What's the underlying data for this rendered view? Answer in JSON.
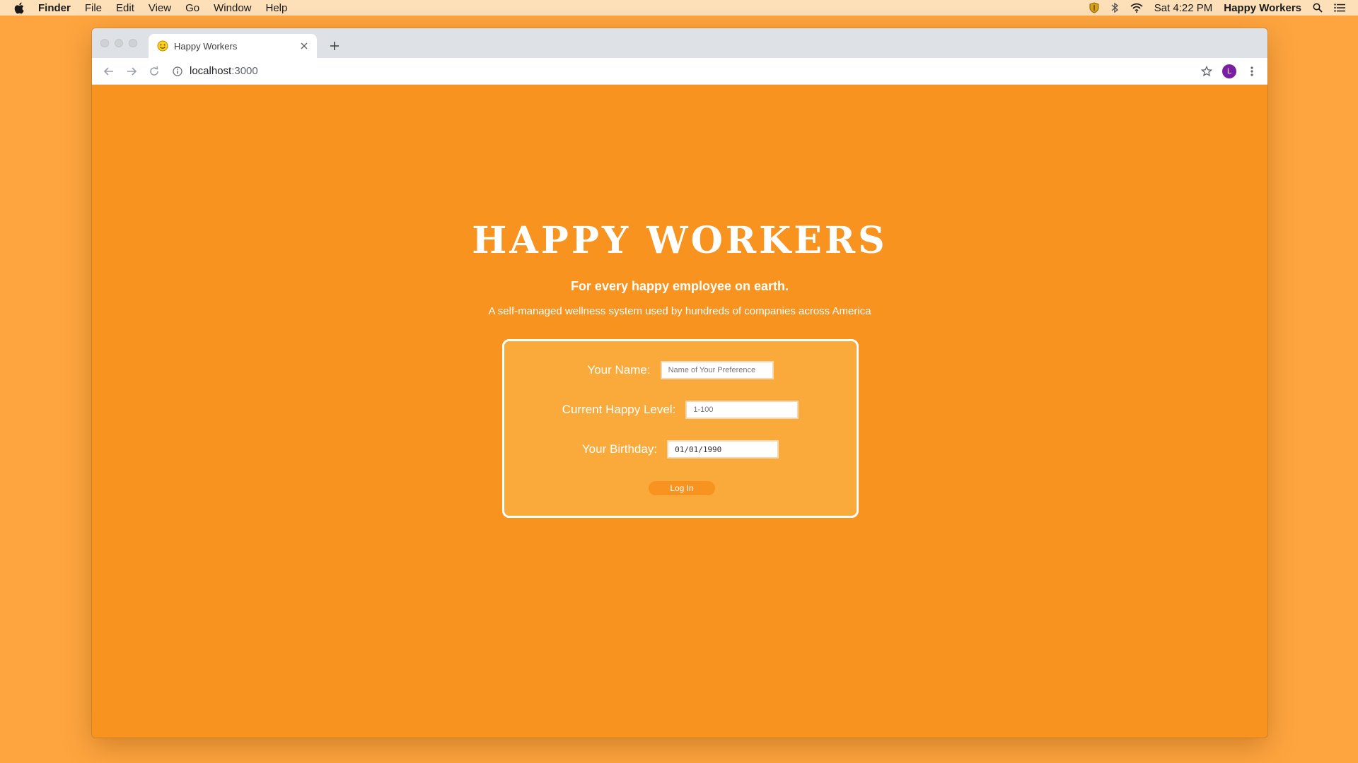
{
  "menubar": {
    "app_name": "Finder",
    "items": [
      "File",
      "Edit",
      "View",
      "Go",
      "Window",
      "Help"
    ],
    "clock": "Sat 4:22 PM",
    "active_window": "Happy Workers"
  },
  "browser": {
    "tab": {
      "title": "Happy Workers"
    },
    "address": {
      "host": "localhost",
      "port": ":3000"
    },
    "profile_initial": "L"
  },
  "page": {
    "title": "HAPPY WORKERS",
    "tagline": "For every happy employee on earth.",
    "subtagline": "A self-managed wellness system used by hundreds of companies across America",
    "form": {
      "name_label": "Your Name:",
      "name_placeholder": "Name of Your Preference",
      "level_label": "Current Happy Level:",
      "level_placeholder": "1-100",
      "birthday_label": "Your Birthday:",
      "birthday_value": "01/01/1990",
      "login_label": "Log In"
    }
  },
  "colors": {
    "page_bg": "#f7931e",
    "card_bg": "#faa93b",
    "desktop_bg": "#fea53f",
    "avatar": "#7b1fa2"
  }
}
